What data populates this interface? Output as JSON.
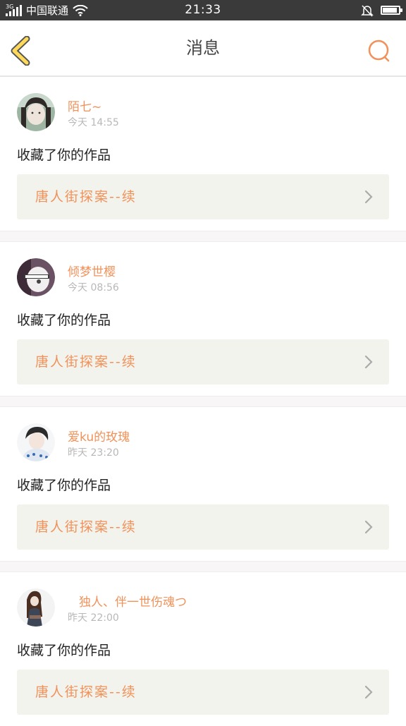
{
  "status_bar": {
    "network_generation": "3G",
    "carrier": "中国联通",
    "time": "21:33"
  },
  "header": {
    "title": "消息"
  },
  "colors": {
    "accent": "#f0925a",
    "back_icon": "#ffd95a",
    "card_bg": "#f3f3ed",
    "status_bar": "#3a3a3a"
  },
  "messages": [
    {
      "username": "陌七~",
      "time": "今天 14:55",
      "action": "收藏了你的作品",
      "work_title": "唐人街探案--续"
    },
    {
      "username": "倾梦世樱",
      "time": "今天 08:56",
      "action": "收藏了你的作品",
      "work_title": "唐人街探案--续"
    },
    {
      "username": "爱ku的玫瑰",
      "time": "昨天 23:20",
      "action": "收藏了你的作品",
      "work_title": "唐人街探案--续"
    },
    {
      "username": "独人、伴一世伤魂つ",
      "time": "昨天 22:00",
      "action": "收藏了你的作品",
      "work_title": "唐人街探案--续"
    }
  ]
}
